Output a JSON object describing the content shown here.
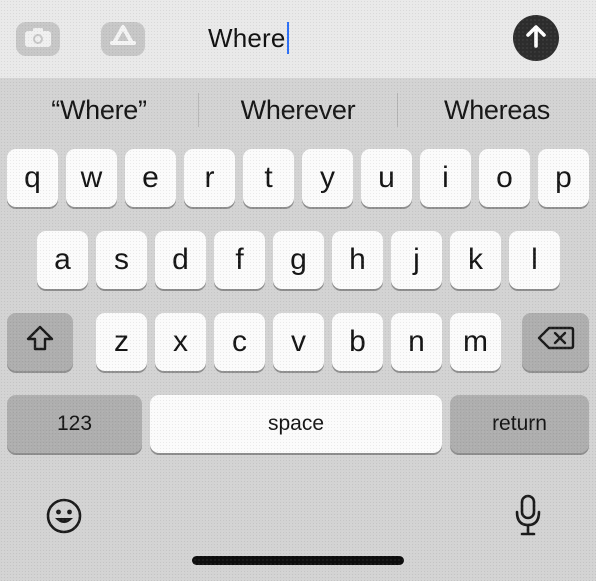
{
  "message_bar": {
    "camera_icon": "camera-icon",
    "apps_icon": "app-store-icon",
    "text_value": "Where",
    "send_icon": "arrow-up-icon"
  },
  "suggestions": [
    "“Where”",
    "Wherever",
    "Whereas"
  ],
  "rows": {
    "row1": [
      "q",
      "w",
      "e",
      "r",
      "t",
      "y",
      "u",
      "i",
      "o",
      "p"
    ],
    "row2": [
      "a",
      "s",
      "d",
      "f",
      "g",
      "h",
      "j",
      "k",
      "l"
    ],
    "row3": [
      "z",
      "x",
      "c",
      "v",
      "b",
      "n",
      "m"
    ]
  },
  "keys": {
    "shift_icon": "shift-icon",
    "delete_icon": "delete-icon",
    "numbers": "123",
    "space": "space",
    "return": "return"
  },
  "bottom": {
    "emoji_icon": "emoji-icon",
    "mic_icon": "microphone-icon"
  },
  "colors": {
    "keyboard_bg": "#d3d3d3",
    "key_bg": "#fbfbfb",
    "special_key_bg": "#aeaeae",
    "caret": "#2b6ef5"
  }
}
